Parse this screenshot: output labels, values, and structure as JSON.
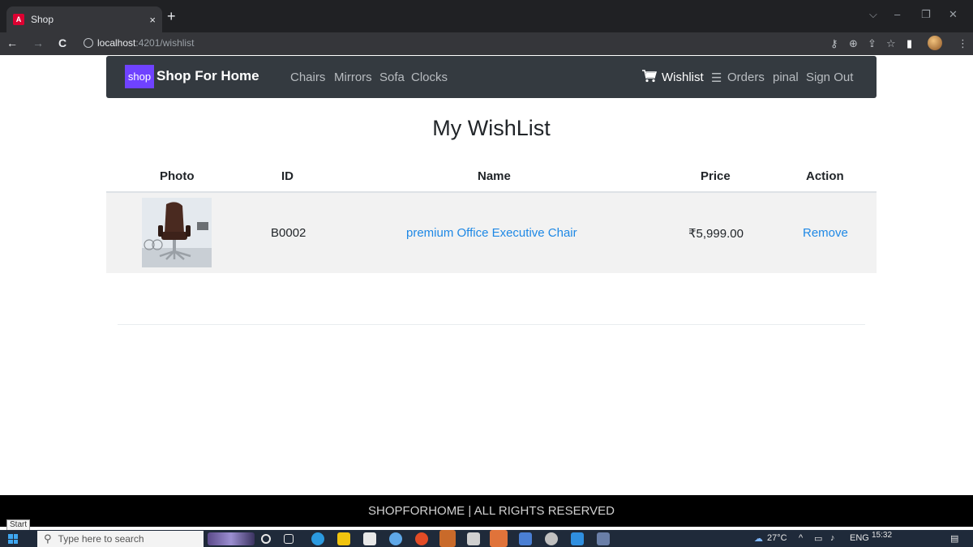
{
  "browser": {
    "tab_title": "Shop",
    "tab_favicon": "A",
    "tab_close": "×",
    "new_tab": "+",
    "url_host": "localhost",
    "url_rest": ":4201/wishlist",
    "window_controls": {
      "down": "⌵",
      "minimize": "–",
      "restore": "❐",
      "close": "✕"
    },
    "nav": {
      "back": "←",
      "forward": "→",
      "reload": "C"
    },
    "toolbar_icons": {
      "key": "⚷",
      "zoom": "⊕",
      "share": "⇪",
      "star": "☆",
      "sidebar": "▮",
      "menu": "⋮"
    }
  },
  "navbar": {
    "logo_text": "shop",
    "brand": "Shop For Home",
    "links": [
      "Chairs",
      "Mirrors",
      "Sofa",
      "Clocks"
    ],
    "wishlist": "Wishlist",
    "orders_icon": "☰",
    "orders": "Orders",
    "user": "pinal",
    "signout": "Sign Out"
  },
  "page": {
    "title": "My WishList"
  },
  "table": {
    "headers": {
      "photo": "Photo",
      "id": "ID",
      "name": "Name",
      "price": "Price",
      "action": "Action"
    },
    "rows": [
      {
        "id": "B0002",
        "name": "premium Office Executive Chair",
        "price": "₹5,999.00",
        "action": "Remove"
      }
    ]
  },
  "footer": {
    "text": "SHOPFORHOME | ALL RIGHTS RESERVED"
  },
  "taskbar": {
    "start_tooltip": "Start",
    "search_placeholder": "Type here to search",
    "weather": "27°C",
    "chevron": "^",
    "language": "ENG",
    "time": "15:32"
  },
  "colors": {
    "navbar_bg": "#343a40",
    "logo_bg": "#6f42ff",
    "link": "#1e88e5",
    "row_bg": "#f2f2f2",
    "footer_bg": "#000000"
  }
}
